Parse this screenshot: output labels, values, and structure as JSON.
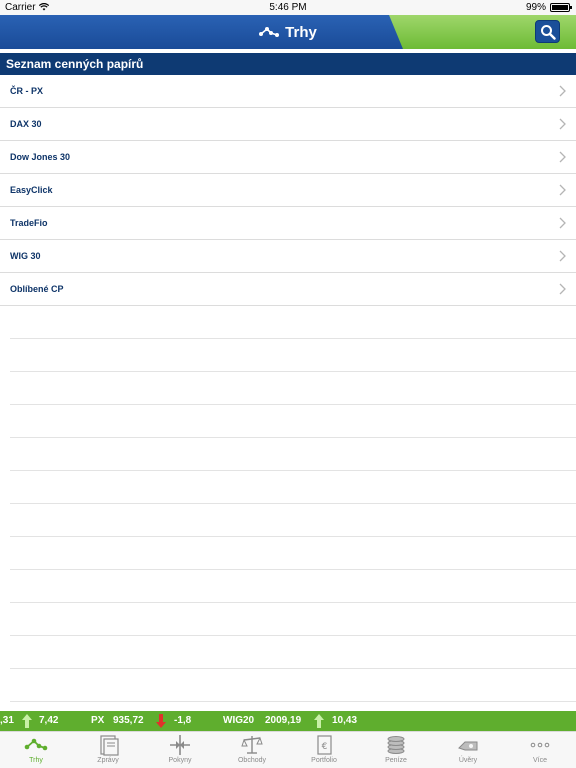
{
  "status_bar": {
    "carrier": "Carrier",
    "time": "5:46 PM",
    "battery": "99%"
  },
  "header": {
    "title": "Trhy",
    "icon": "trend-icon",
    "search_icon": "search-icon"
  },
  "section": {
    "title": "Seznam cenných papírů"
  },
  "list": {
    "items": [
      {
        "label": "ČR - PX"
      },
      {
        "label": "DAX 30"
      },
      {
        "label": "Dow Jones 30"
      },
      {
        "label": "EasyClick"
      },
      {
        "label": "TradeFio"
      },
      {
        "label": "WIG 30"
      },
      {
        "label": "Oblíbené CP"
      }
    ]
  },
  "ticker": {
    "partial_value": ",31",
    "partial_change": "7,42",
    "px_name": "PX",
    "px_value": "935,72",
    "px_change": "-1,8",
    "wig_name": "WIG20",
    "wig_value": "2009,19",
    "wig_change": "10,43"
  },
  "tabs": [
    {
      "label": "Trhy",
      "icon": "markets-icon",
      "active": true
    },
    {
      "label": "Zprávy",
      "icon": "news-icon"
    },
    {
      "label": "Pokyny",
      "icon": "orders-icon"
    },
    {
      "label": "Obchody",
      "icon": "scales-icon"
    },
    {
      "label": "Portfolio",
      "icon": "portfolio-icon"
    },
    {
      "label": "Peníze",
      "icon": "coins-icon"
    },
    {
      "label": "Úvěry",
      "icon": "loans-icon"
    },
    {
      "label": "Více",
      "icon": "more-icon"
    }
  ],
  "colors": {
    "header_blue": "#1a4b98",
    "section_navy": "#0e3a73",
    "accent_green": "#5fae2e",
    "down_red": "#e0312b"
  }
}
